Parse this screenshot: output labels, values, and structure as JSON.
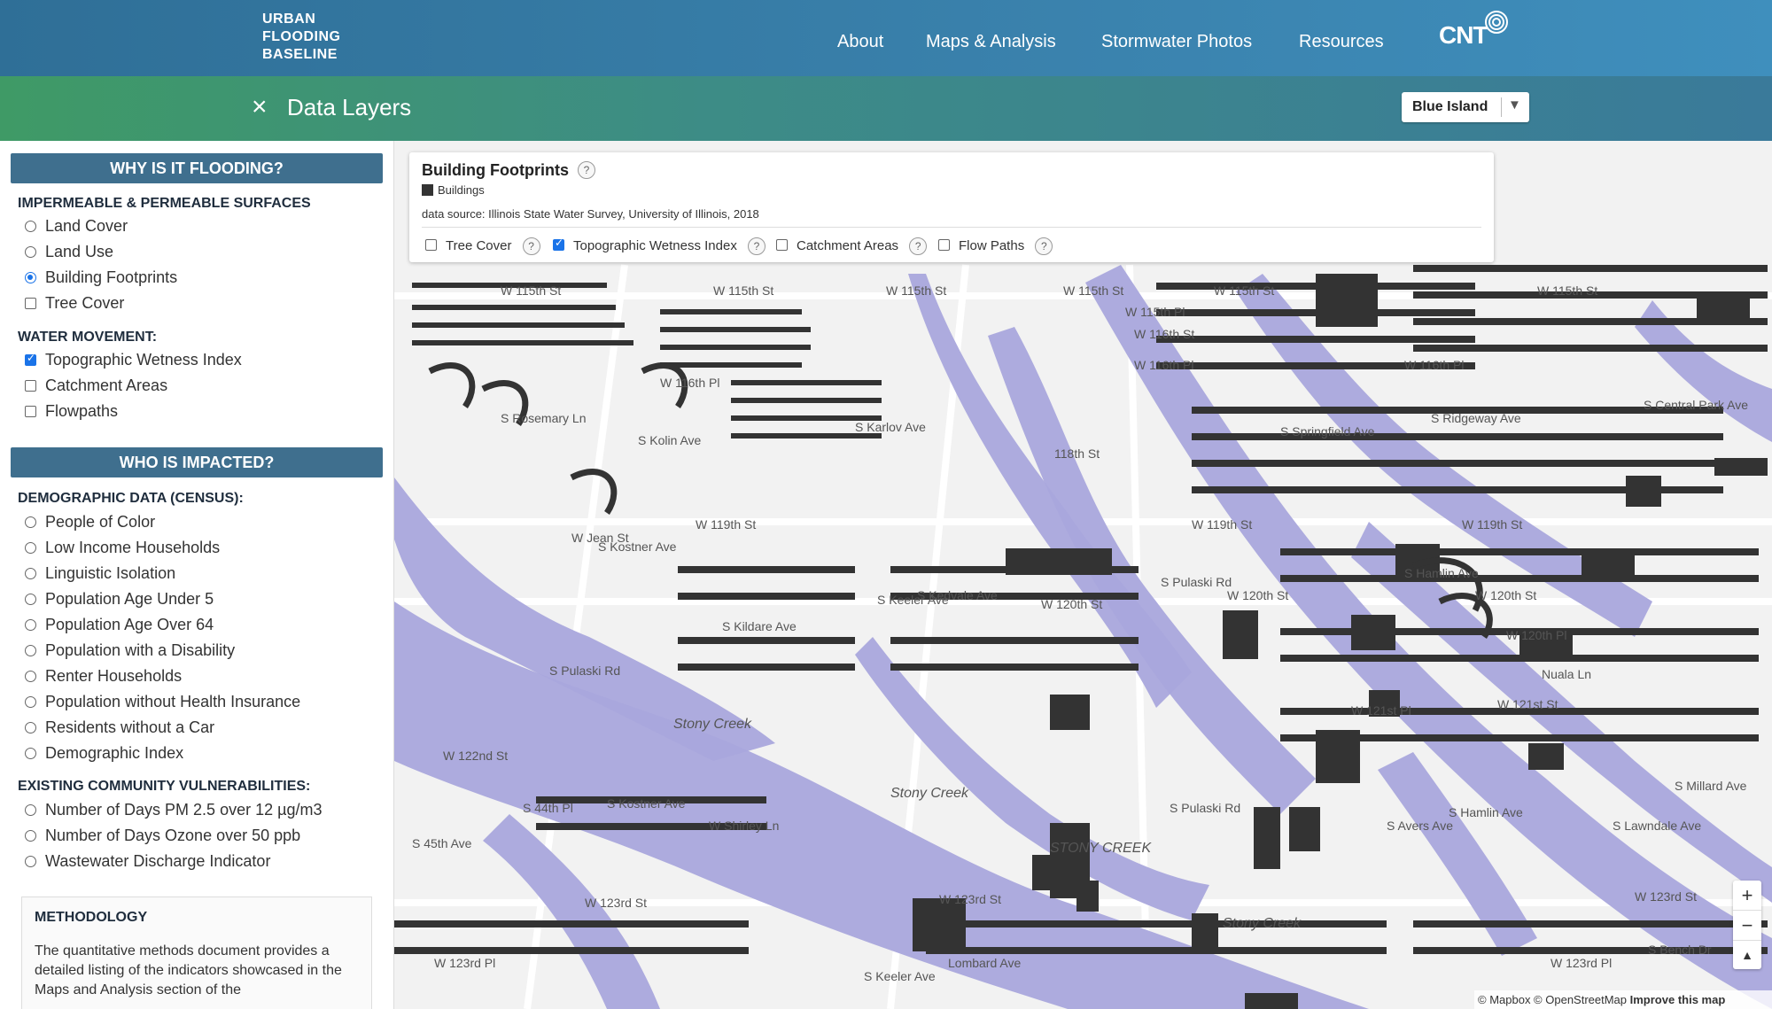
{
  "header": {
    "logo_lines": [
      "URBAN",
      "FLOODING",
      "BASELINE"
    ],
    "nav": [
      "About",
      "Maps & Analysis",
      "Stormwater Photos",
      "Resources"
    ],
    "brand": "CNT"
  },
  "subheader": {
    "close_icon": "×",
    "title": "Data Layers",
    "city_selected": "Blue Island",
    "dropdown_icon": "▼"
  },
  "sidebar": {
    "section1": "WHY IS IT FLOODING?",
    "group1": {
      "title": "IMPERMEABLE & PERMEABLE SURFACES",
      "items": [
        {
          "label": "Land Cover",
          "type": "radio",
          "checked": false
        },
        {
          "label": "Land Use",
          "type": "radio",
          "checked": false
        },
        {
          "label": "Building Footprints",
          "type": "radio",
          "checked": true
        },
        {
          "label": "Tree Cover",
          "type": "checkbox",
          "checked": false
        }
      ]
    },
    "group2": {
      "title": "WATER MOVEMENT:",
      "items": [
        {
          "label": "Topographic Wetness Index",
          "type": "checkbox",
          "checked": true
        },
        {
          "label": "Catchment Areas",
          "type": "checkbox",
          "checked": false
        },
        {
          "label": "Flowpaths",
          "type": "checkbox",
          "checked": false
        }
      ]
    },
    "section2": "WHO IS IMPACTED?",
    "group3": {
      "title": "DEMOGRAPHIC DATA (CENSUS):",
      "items": [
        "People of Color",
        "Low Income Households",
        "Linguistic Isolation",
        "Population Age Under 5",
        "Population Age Over 64",
        "Population with a Disability",
        "Renter Households",
        "Population without Health Insurance",
        "Residents without a Car",
        "Demographic Index"
      ]
    },
    "group4": {
      "title": "EXISTING COMMUNITY VULNERABILITIES:",
      "items": [
        "Number of Days PM 2.5 over 12 µg/m3",
        "Number of Days Ozone over 50 ppb",
        "Wastewater Discharge Indicator"
      ]
    },
    "methodology": {
      "title": "METHODOLOGY",
      "body": "The quantitative methods document provides a detailed listing of the indicators showcased in the Maps and Analysis section of the"
    }
  },
  "legend": {
    "title": "Building Footprints",
    "help": "?",
    "swatch_label": "Buildings",
    "source": "data source: Illinois State Water Survey, University of Illinois, 2018",
    "options": [
      {
        "label": "Tree Cover",
        "checked": false
      },
      {
        "label": "Topographic Wetness Index",
        "checked": true
      },
      {
        "label": "Catchment Areas",
        "checked": false
      },
      {
        "label": "Flow Paths",
        "checked": false
      }
    ]
  },
  "map": {
    "streets": {
      "w115_a": "W 115th St",
      "w115_b": "W 115th St",
      "w115_c": "W 115th St",
      "w115_d": "W 115th St",
      "w115_e": "W 115th St",
      "w115_f": "W 115th St",
      "w115pl": "W 115th Pl",
      "w116": "W 116th St",
      "w116pl": "W 116th Pl",
      "w116pl_b": "W 116th Pl",
      "w118": "118th St",
      "w119_a": "W 119th St",
      "w119_b": "W 119th St",
      "w119_c": "W 119th St",
      "w120_a": "W 120th St",
      "w120_b": "W 120th St",
      "w120_c": "W 120th St",
      "w120pl": "W 120th Pl",
      "w121": "W 121st St",
      "w121pl": "W 121st Pl",
      "w122": "W 122nd St",
      "w123_a": "W 123rd St",
      "w123_b": "W 123rd St",
      "w123_c": "W 123rd St",
      "w123pl": "W 123rd Pl",
      "w123pl_b": "W 123rd Pl",
      "pulaski_a": "S Pulaski Rd",
      "pulaski_b": "S Pulaski Rd",
      "pulaski_c": "S Pulaski Rd",
      "kostner_a": "S Kostner Ave",
      "kostner_b": "S Kostner Ave",
      "keeler_a": "S Keeler Ave",
      "keeler_b": "S Keeler Ave",
      "kildare": "S Kildare Ave",
      "kedvale": "S Kedvale Ave",
      "hamlin_a": "S Hamlin Ave",
      "hamlin_b": "S Hamlin Ave",
      "springfield": "S Springfield Ave",
      "avers": "S Avers Ave",
      "ridgeway": "S Ridgeway Ave",
      "lawndale": "S Lawndale Ave",
      "millard": "S Millard Ave",
      "central_park": "S Central Park Ave",
      "karlov": "S Karlov Ave",
      "shirley": "W Shirley Ln",
      "lombard": "Lombard Ave",
      "s45th": "S 45th Ave",
      "s44th": "S 44th Pl",
      "jean": "W Jean St",
      "nuala": "Nuala Ln",
      "rosemary": "S Rosemary Ln",
      "kolin": "S Kolin Ave",
      "w116pl_c": "W 116th Pl",
      "bench": "S Bench Dr"
    },
    "creeks": [
      "Stony Creek",
      "Stony Creek",
      "STONY CREEK",
      "Stony Creek"
    ],
    "zoom_in": "+",
    "zoom_out": "−",
    "compass": "▲",
    "attribution_prefix": "© Mapbox © OpenStreetMap ",
    "attribution_link": "Improve this map"
  }
}
